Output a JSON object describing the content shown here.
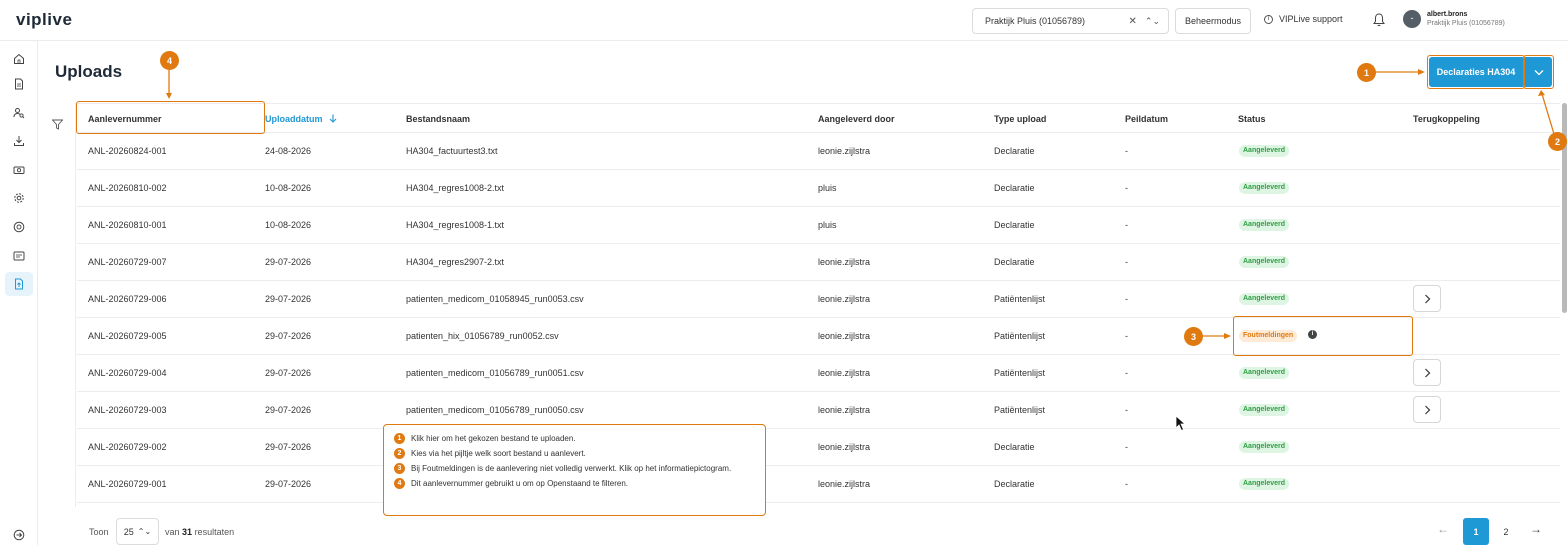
{
  "app": {
    "logo": "viplive"
  },
  "topbar": {
    "practice_select": "Praktijk Pluis (01056789)",
    "clear_icon": "close-icon",
    "beheer_button": "Beheermodus",
    "support_link": "VIPLive support",
    "user_avatar": "-",
    "user_name": "albert.brons",
    "user_practice": "Praktijk Pluis (01056789)"
  },
  "sidebar": {
    "items": [
      {
        "icon": "home-icon"
      },
      {
        "icon": "document-icon"
      },
      {
        "icon": "user-search-icon"
      },
      {
        "icon": "download-icon"
      },
      {
        "icon": "money-icon"
      },
      {
        "icon": "gear-icon"
      },
      {
        "icon": "info-circle-icon"
      },
      {
        "icon": "message-icon"
      },
      {
        "icon": "upload-document-icon",
        "active": true
      }
    ],
    "bottom_icon": "logout-icon"
  },
  "page": {
    "title": "Uploads",
    "upload_button": "Declaraties HA304"
  },
  "table": {
    "columns": [
      "Aanlevernummer",
      "Uploaddatum",
      "Bestandsnaam",
      "Aangeleverd door",
      "Type upload",
      "Peildatum",
      "Status",
      "Terugkoppeling"
    ],
    "sorted_column": "Uploaddatum",
    "sort_icon": "arrow-down-icon",
    "rows": [
      {
        "nr": "ANL-20260824-001",
        "datum": "24-08-2026",
        "bestand": "HA304_factuurtest3.txt",
        "door": "leonie.zijlstra",
        "type": "Declaratie",
        "peil": "-",
        "status": "Aangeleverd",
        "status_kind": "ok",
        "terugkoppeling": false
      },
      {
        "nr": "ANL-20260810-002",
        "datum": "10-08-2026",
        "bestand": "HA304_regres1008-2.txt",
        "door": "pluis",
        "type": "Declaratie",
        "peil": "-",
        "status": "Aangeleverd",
        "status_kind": "ok",
        "terugkoppeling": false
      },
      {
        "nr": "ANL-20260810-001",
        "datum": "10-08-2026",
        "bestand": "HA304_regres1008-1.txt",
        "door": "pluis",
        "type": "Declaratie",
        "peil": "-",
        "status": "Aangeleverd",
        "status_kind": "ok",
        "terugkoppeling": false
      },
      {
        "nr": "ANL-20260729-007",
        "datum": "29-07-2026",
        "bestand": "HA304_regres2907-2.txt",
        "door": "leonie.zijlstra",
        "type": "Declaratie",
        "peil": "-",
        "status": "Aangeleverd",
        "status_kind": "ok",
        "terugkoppeling": false
      },
      {
        "nr": "ANL-20260729-006",
        "datum": "29-07-2026",
        "bestand": "patienten_medicom_01058945_run0053.csv",
        "door": "leonie.zijlstra",
        "type": "Patiëntenlijst",
        "peil": "-",
        "status": "Aangeleverd",
        "status_kind": "ok",
        "terugkoppeling": true
      },
      {
        "nr": "ANL-20260729-005",
        "datum": "29-07-2026",
        "bestand": "patienten_hix_01056789_run0052.csv",
        "door": "leonie.zijlstra",
        "type": "Patiëntenlijst",
        "peil": "-",
        "status": "Foutmeldingen",
        "status_kind": "err",
        "terugkoppeling": false
      },
      {
        "nr": "ANL-20260729-004",
        "datum": "29-07-2026",
        "bestand": "patienten_medicom_01056789_run0051.csv",
        "door": "leonie.zijlstra",
        "type": "Patiëntenlijst",
        "peil": "-",
        "status": "Aangeleverd",
        "status_kind": "ok",
        "terugkoppeling": true
      },
      {
        "nr": "ANL-20260729-003",
        "datum": "29-07-2026",
        "bestand": "patienten_medicom_01056789_run0050.csv",
        "door": "leonie.zijlstra",
        "type": "Patiëntenlijst",
        "peil": "-",
        "status": "Aangeleverd",
        "status_kind": "ok",
        "terugkoppeling": true
      },
      {
        "nr": "ANL-20260729-002",
        "datum": "29-07-2026",
        "bestand": "",
        "door": "leonie.zijlstra",
        "type": "Declaratie",
        "peil": "-",
        "status": "Aangeleverd",
        "status_kind": "ok",
        "terugkoppeling": false
      },
      {
        "nr": "ANL-20260729-001",
        "datum": "29-07-2026",
        "bestand": "",
        "door": "leonie.zijlstra",
        "type": "Declaratie",
        "peil": "-",
        "status": "Aangeleverd",
        "status_kind": "ok",
        "terugkoppeling": false
      }
    ]
  },
  "footer": {
    "toon_label": "Toon",
    "page_size": "25",
    "total_prefix": "van",
    "total_count": "31",
    "total_suffix": "resultaten",
    "pages": [
      "1",
      "2"
    ],
    "current_page": "1"
  },
  "tutorial": {
    "markers": [
      "1",
      "2",
      "3",
      "4"
    ],
    "tips": [
      {
        "num": "1",
        "text": "Klik hier om het gekozen bestand te uploaden."
      },
      {
        "num": "2",
        "text": "Kies via het pijltje welk soort bestand u aanlevert."
      },
      {
        "num": "3",
        "text": "Bij Foutmeldingen is de aanlevering niet volledig verwerkt. Klik op het informatiepictogram."
      },
      {
        "num": "4",
        "text": "Dit aanlevernummer gebruikt u om op Openstaand te filteren."
      }
    ],
    "accent_color": "#e07a10"
  },
  "colors": {
    "primary": "#1f98d6",
    "success_bg": "#dff5e3",
    "success_text": "#2f9e44",
    "error_bg": "#fdebd7",
    "error_text": "#e07a10"
  }
}
